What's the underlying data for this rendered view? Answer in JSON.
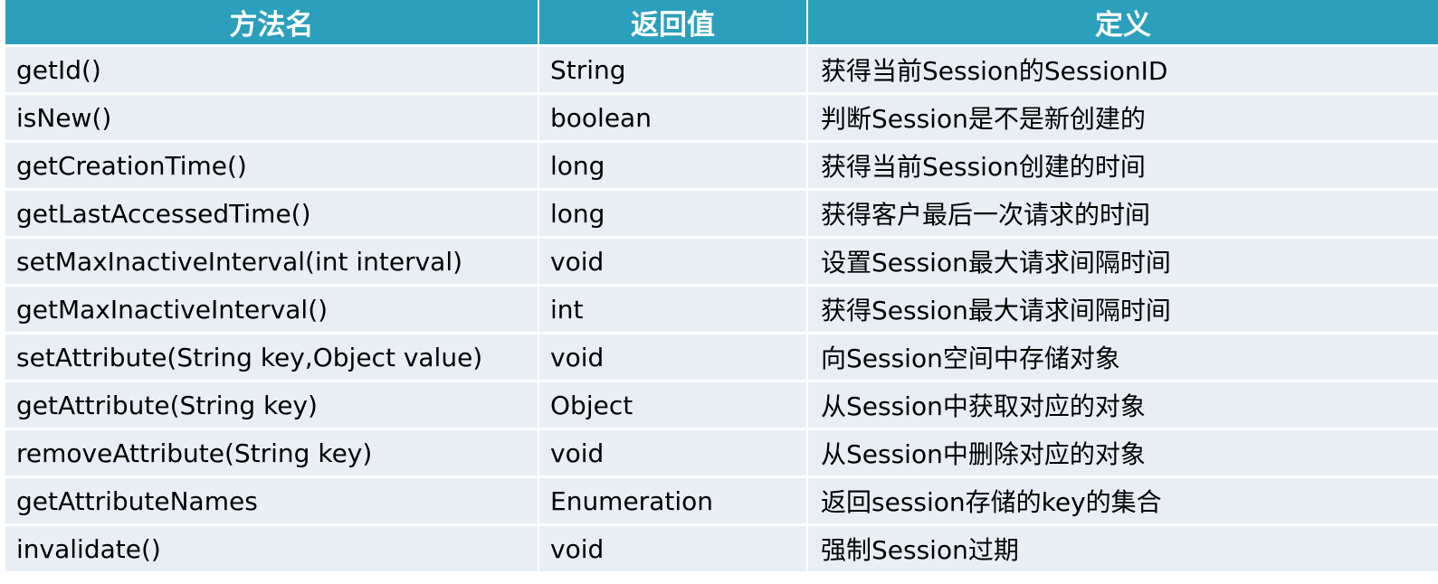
{
  "headers": [
    "方法名",
    "返回值",
    "定义"
  ],
  "rows": [
    [
      "getId()",
      "String",
      "获得当前Session的SessionID"
    ],
    [
      "isNew()",
      "boolean",
      "判断Session是不是新创建的"
    ],
    [
      "getCreationTime()",
      "long",
      "获得当前Session创建的时间"
    ],
    [
      "getLastAccessedTime()",
      "long",
      "获得客户最后一次请求的时间"
    ],
    [
      "setMaxInactiveInterval(int interval)",
      "void",
      "设置Session最大请求间隔时间"
    ],
    [
      "getMaxInactiveInterval()",
      "int",
      "获得Session最大请求间隔时间"
    ],
    [
      "setAttribute(String key,Object value)",
      "void",
      "向Session空间中存储对象"
    ],
    [
      "getAttribute(String key)",
      "Object",
      "从Session中获取对应的对象"
    ],
    [
      "removeAttribute(String key)",
      "void",
      "从Session中删除对应的对象"
    ],
    [
      "getAttributeNames",
      "Enumeration",
      "返回session存储的key的集合"
    ],
    [
      "invalidate()",
      "void",
      "强制Session过期"
    ]
  ],
  "colors": {
    "header_bg": "#2b9fbc",
    "header_text": "#ffffff",
    "row_bg": "#e9edf4",
    "row_text": "#000000"
  }
}
